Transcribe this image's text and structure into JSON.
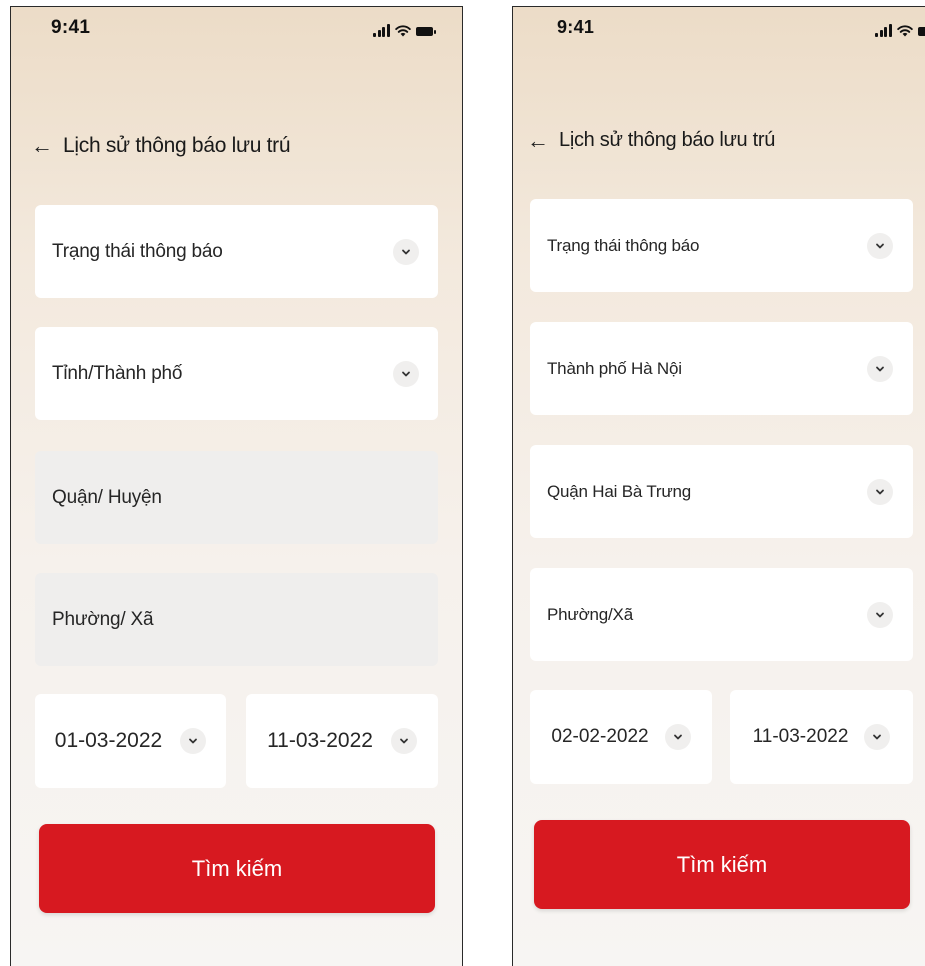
{
  "left": {
    "status": {
      "time": "9:41"
    },
    "header": {
      "title": "Lịch sử thông báo lưu trú"
    },
    "fields": [
      {
        "label": "Trạng thái thông báo",
        "enabled": true
      },
      {
        "label": "Tỉnh/Thành phố",
        "enabled": true
      },
      {
        "label": "Quận/ Huyện",
        "enabled": false
      },
      {
        "label": "Phường/ Xã",
        "enabled": false
      }
    ],
    "dates": {
      "from": "01-03-2022",
      "to": "11-03-2022"
    },
    "search_label": "Tìm kiếm"
  },
  "right": {
    "status": {
      "time": "9:41"
    },
    "header": {
      "title": "Lịch sử thông báo lưu trú"
    },
    "fields": [
      {
        "label": "Trạng thái thông báo",
        "enabled": true
      },
      {
        "label": "Thành phố Hà Nội",
        "enabled": true
      },
      {
        "label": "Quận Hai Bà Trưng",
        "enabled": true
      },
      {
        "label": "Phường/Xã",
        "enabled": true
      }
    ],
    "dates": {
      "from": "02-02-2022",
      "to": "11-03-2022"
    },
    "search_label": "Tìm kiếm"
  },
  "colors": {
    "primary_button": "#d71920",
    "field_background": "#ffffff",
    "disabled_field_background": "#efeeed"
  },
  "icons": {
    "back": "arrow-left-icon",
    "dropdown": "chevron-down-icon",
    "signal": "signal-icon",
    "wifi": "wifi-icon",
    "battery": "battery-icon"
  }
}
